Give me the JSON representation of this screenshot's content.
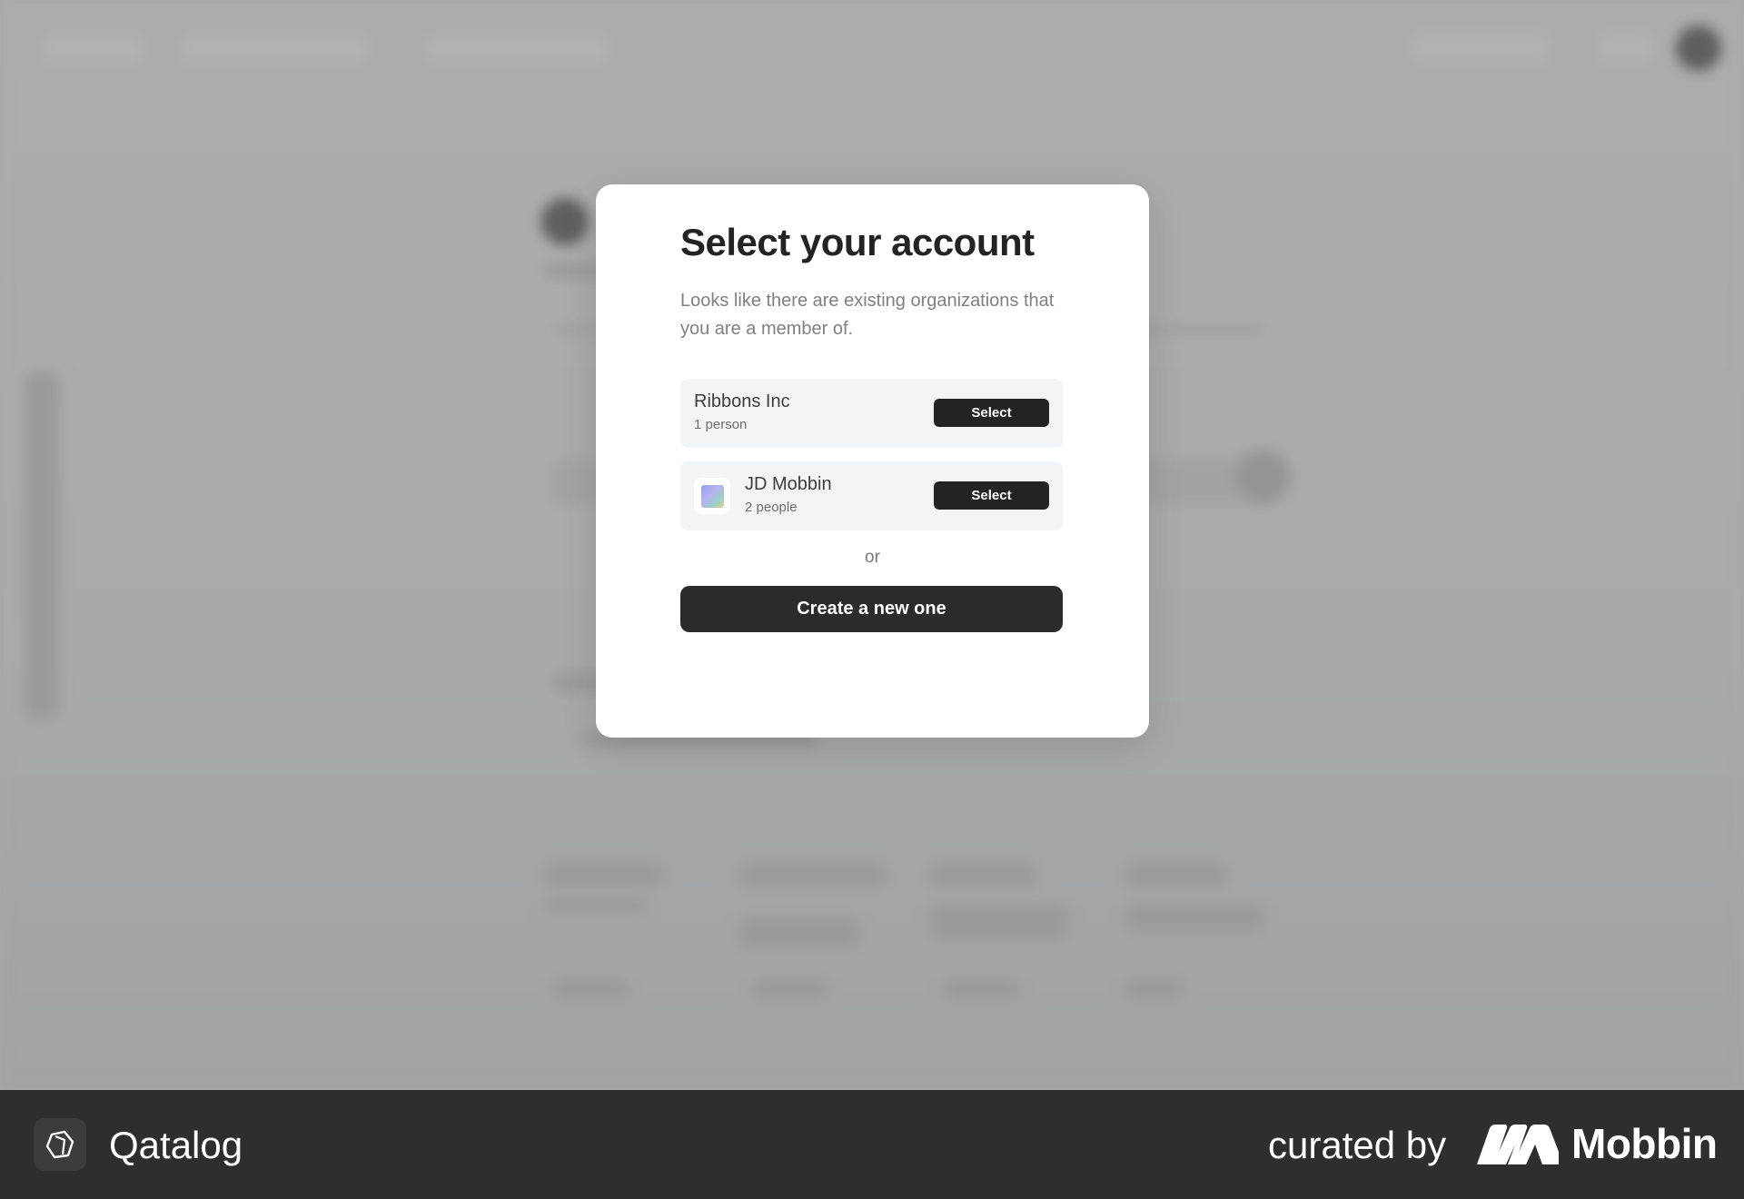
{
  "modal": {
    "title": "Select your account",
    "description": "Looks like there are existing organizations that you are a member of.",
    "organizations": [
      {
        "name": "Ribbons Inc",
        "members": "1 person",
        "select_label": "Select"
      },
      {
        "name": "JD Mobbin",
        "members": "2 people",
        "select_label": "Select"
      }
    ],
    "or_text": "or",
    "create_label": "Create a new one"
  },
  "footer": {
    "brand_name": "Qatalog",
    "curated_label": "curated by",
    "curator_name": "Mobbin"
  },
  "colors": {
    "overlay": "#a8a8a8",
    "button_dark": "#232323",
    "footer_bg": "#2e2e2e"
  }
}
